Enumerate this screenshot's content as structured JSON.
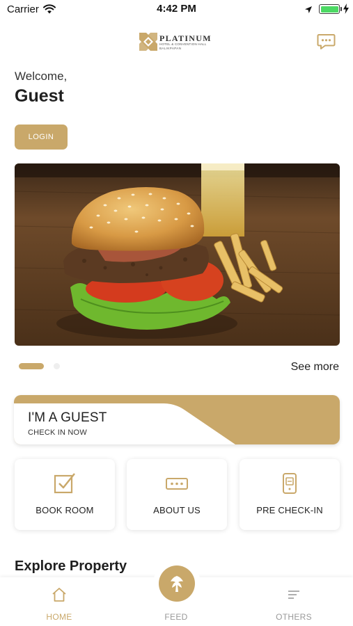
{
  "status_bar": {
    "carrier": "Carrier",
    "time": "4:42 PM",
    "icons": [
      "wifi-icon",
      "location-arrow-icon",
      "battery-icon",
      "charging-bolt-icon"
    ]
  },
  "header": {
    "logo": {
      "name": "PLATINUM",
      "subtitle": "HOTEL & CONVENTION HALL",
      "city": "BALIKPAPAN"
    },
    "chat_icon": "chat-bubble-icon"
  },
  "welcome": {
    "greeting": "Welcome,",
    "name": "Guest",
    "login_label": "LOGIN"
  },
  "banner": {
    "slide_index": 0,
    "slide_count": 2,
    "see_more_label": "See more"
  },
  "guest_card": {
    "title": "I'M A GUEST",
    "subtitle": "CHECK IN NOW"
  },
  "tiles": [
    {
      "label": "BOOK ROOM",
      "icon": "checkbox-edit-icon"
    },
    {
      "label": "ABOUT US",
      "icon": "ticket-icon"
    },
    {
      "label": "PRE CHECK-IN",
      "icon": "phone-card-icon"
    }
  ],
  "explore": {
    "title": "Explore Property"
  },
  "bottom_nav": {
    "items": [
      {
        "label": "HOME",
        "icon": "home-icon",
        "active": true
      },
      {
        "label": "FEED",
        "icon": "feed-logo-icon",
        "active": false
      },
      {
        "label": "OTHERS",
        "icon": "menu-lines-icon",
        "active": false
      }
    ]
  },
  "colors": {
    "accent": "#c9a86a",
    "text": "#1f1f1f",
    "muted": "#999999",
    "battery": "#4cd964"
  }
}
